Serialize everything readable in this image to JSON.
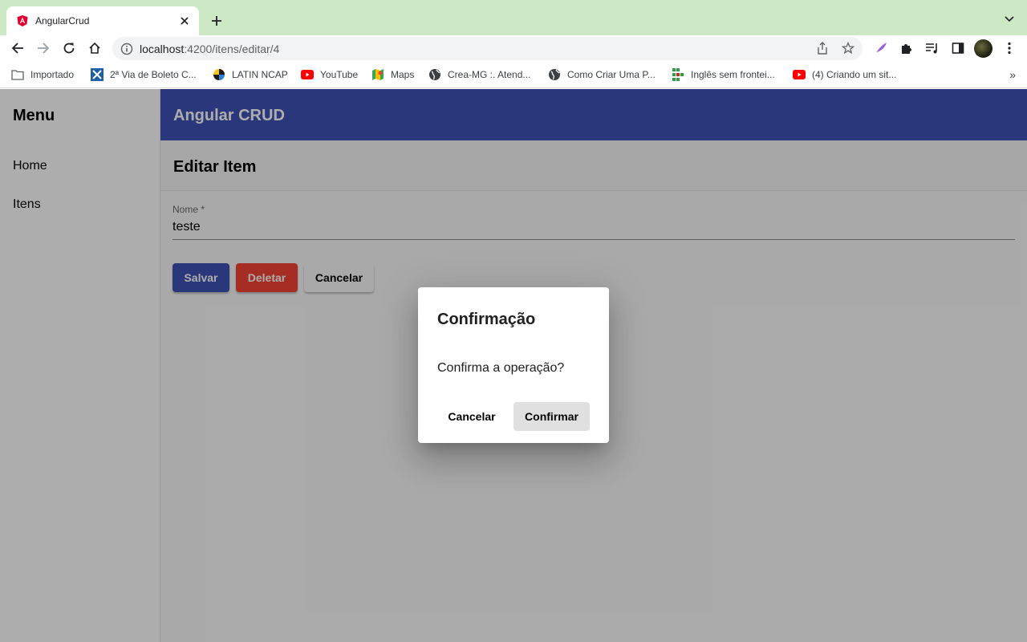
{
  "browser": {
    "tab_title": "AngularCrud",
    "url_host": "localhost",
    "url_path": ":4200/itens/editar/4",
    "bookmarks": [
      {
        "label": "Importado",
        "icon": "folder-icon"
      },
      {
        "label": "2ª Via de Boleto C...",
        "icon": "boleto-icon"
      },
      {
        "label": "LATIN NCAP",
        "icon": "latin-ncap-icon"
      },
      {
        "label": "YouTube",
        "icon": "youtube-icon"
      },
      {
        "label": "Maps",
        "icon": "maps-icon"
      },
      {
        "label": "Crea-MG :. Atend...",
        "icon": "globe-icon"
      },
      {
        "label": "Como Criar Uma P...",
        "icon": "globe-icon"
      },
      {
        "label": "Inglês sem frontei...",
        "icon": "green-grid-icon"
      },
      {
        "label": "(4) Criando um sit...",
        "icon": "youtube-icon"
      }
    ],
    "more_bookmarks": "»"
  },
  "sidenav": {
    "title": "Menu",
    "items": [
      {
        "label": "Home"
      },
      {
        "label": "Itens"
      }
    ]
  },
  "header": {
    "title": "Angular CRUD"
  },
  "page": {
    "title": "Editar Item",
    "name_label": "Nome *",
    "name_value": "teste",
    "save_label": "Salvar",
    "delete_label": "Deletar",
    "cancel_label": "Cancelar"
  },
  "dialog": {
    "title": "Confirmação",
    "message": "Confirma a operação?",
    "cancel_label": "Cancelar",
    "confirm_label": "Confirmar"
  },
  "colors": {
    "primary": "#3f51b5",
    "warn": "#f44336",
    "tabstrip": "#cde8c5"
  }
}
